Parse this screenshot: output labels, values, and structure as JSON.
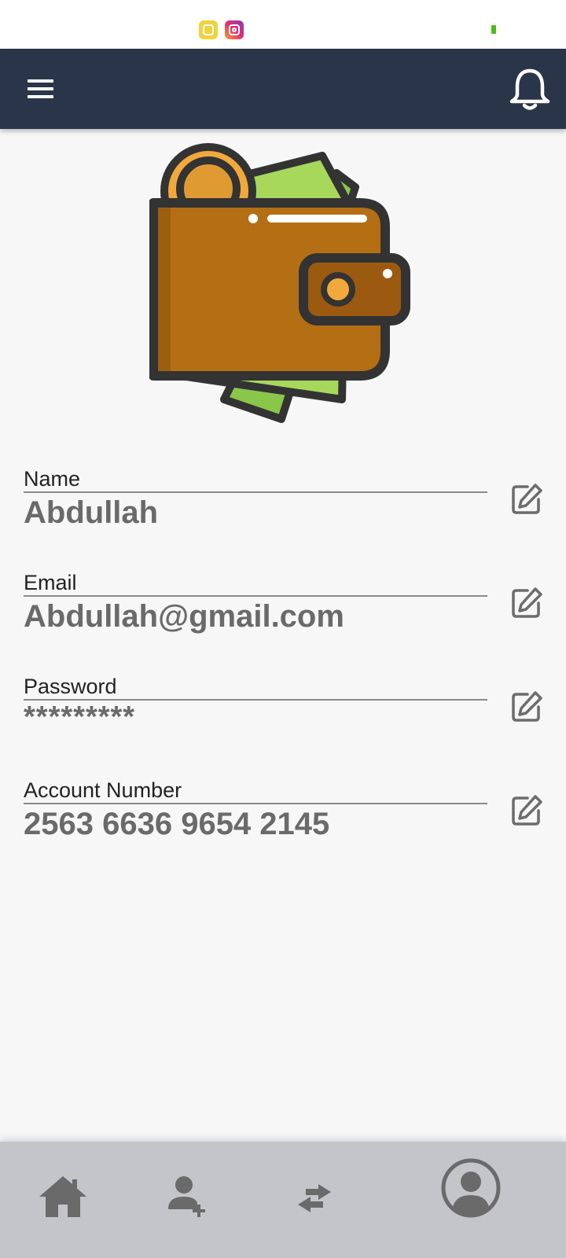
{
  "status_bar": {
    "icons": [
      "yellow-app-icon",
      "instagram-icon",
      "battery-icon"
    ]
  },
  "app_bar": {
    "menu_icon": "hamburger-menu-icon",
    "notification_icon": "bell-icon"
  },
  "logo": {
    "icon": "wallet-icon"
  },
  "profile": {
    "fields": [
      {
        "label": "Name",
        "value": "Abdullah"
      },
      {
        "label": "Email",
        "value": "Abdullah@gmail.com"
      },
      {
        "label": "Password",
        "value": "*********"
      },
      {
        "label": "Account Number",
        "value": "2563 6636 9654 2145"
      }
    ]
  },
  "bottom_nav": {
    "items": [
      "home-icon",
      "add-user-icon",
      "transfer-icon",
      "profile-icon"
    ]
  },
  "colors": {
    "app_bar": "#2b3549",
    "background": "#f7f7f7",
    "bottom_nav": "#c4c5c8",
    "wallet_brown": "#b46f14",
    "cash_green": "#8ac64a",
    "coin_orange": "#f2a93b"
  }
}
